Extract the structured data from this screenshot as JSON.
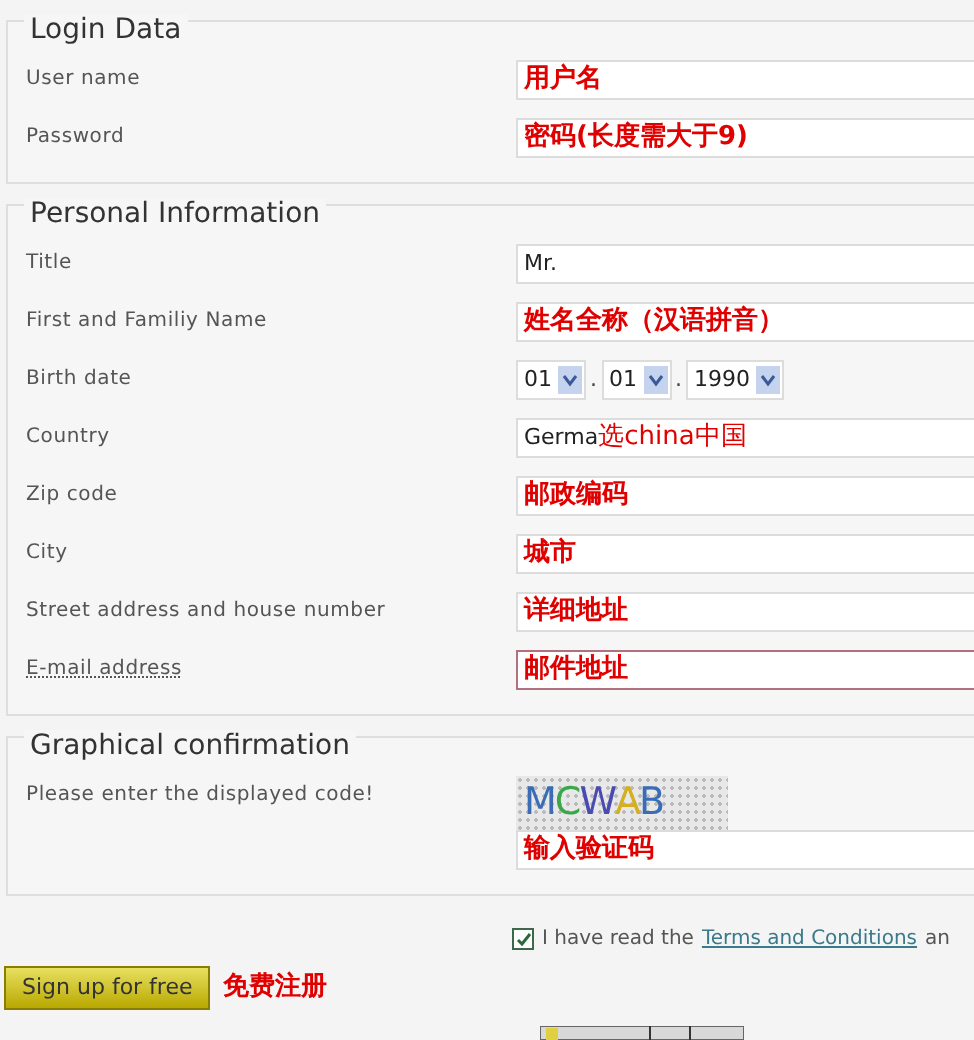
{
  "sections": [
    {
      "legend": "Login Data",
      "rows": [
        {
          "kind": "text",
          "label": "User name",
          "value": "用户名",
          "note": true
        },
        {
          "kind": "text",
          "label": "Password",
          "value": "密码(长度需大于9)",
          "note": true
        }
      ]
    },
    {
      "legend": "Personal Information",
      "rows": [
        {
          "kind": "text",
          "label": "Title",
          "value": "Mr.",
          "note": false
        },
        {
          "kind": "text",
          "label": "First and Familiy Name",
          "value": "姓名全称（汉语拼音）",
          "note": true
        },
        {
          "kind": "date",
          "label": "Birth date",
          "parts": [
            "01",
            "01",
            "1990"
          ],
          "separator": "."
        },
        {
          "kind": "select",
          "label": "Country",
          "value": "Germa",
          "annotation": "选china中国"
        },
        {
          "kind": "text",
          "label": "Zip code",
          "value": "邮政编码",
          "note": true
        },
        {
          "kind": "text",
          "label": "City",
          "value": "城市",
          "note": true
        },
        {
          "kind": "text",
          "label": "Street address and house number",
          "value": "详细地址",
          "note": true
        },
        {
          "kind": "text",
          "label": "E-mail address",
          "value": "邮件地址",
          "note": true,
          "focused": true
        }
      ]
    },
    {
      "legend": "Graphical confirmation",
      "rows": [
        {
          "kind": "captcha",
          "label": "Please enter the displayed code!",
          "code": "MCWAB",
          "value": "输入验证码",
          "note": true
        }
      ]
    }
  ],
  "terms": {
    "checked": true,
    "before": "I have read the",
    "link": "Terms and Conditions",
    "after": "an"
  },
  "submit": {
    "label": "Sign up for free",
    "annotation": "免费注册"
  }
}
